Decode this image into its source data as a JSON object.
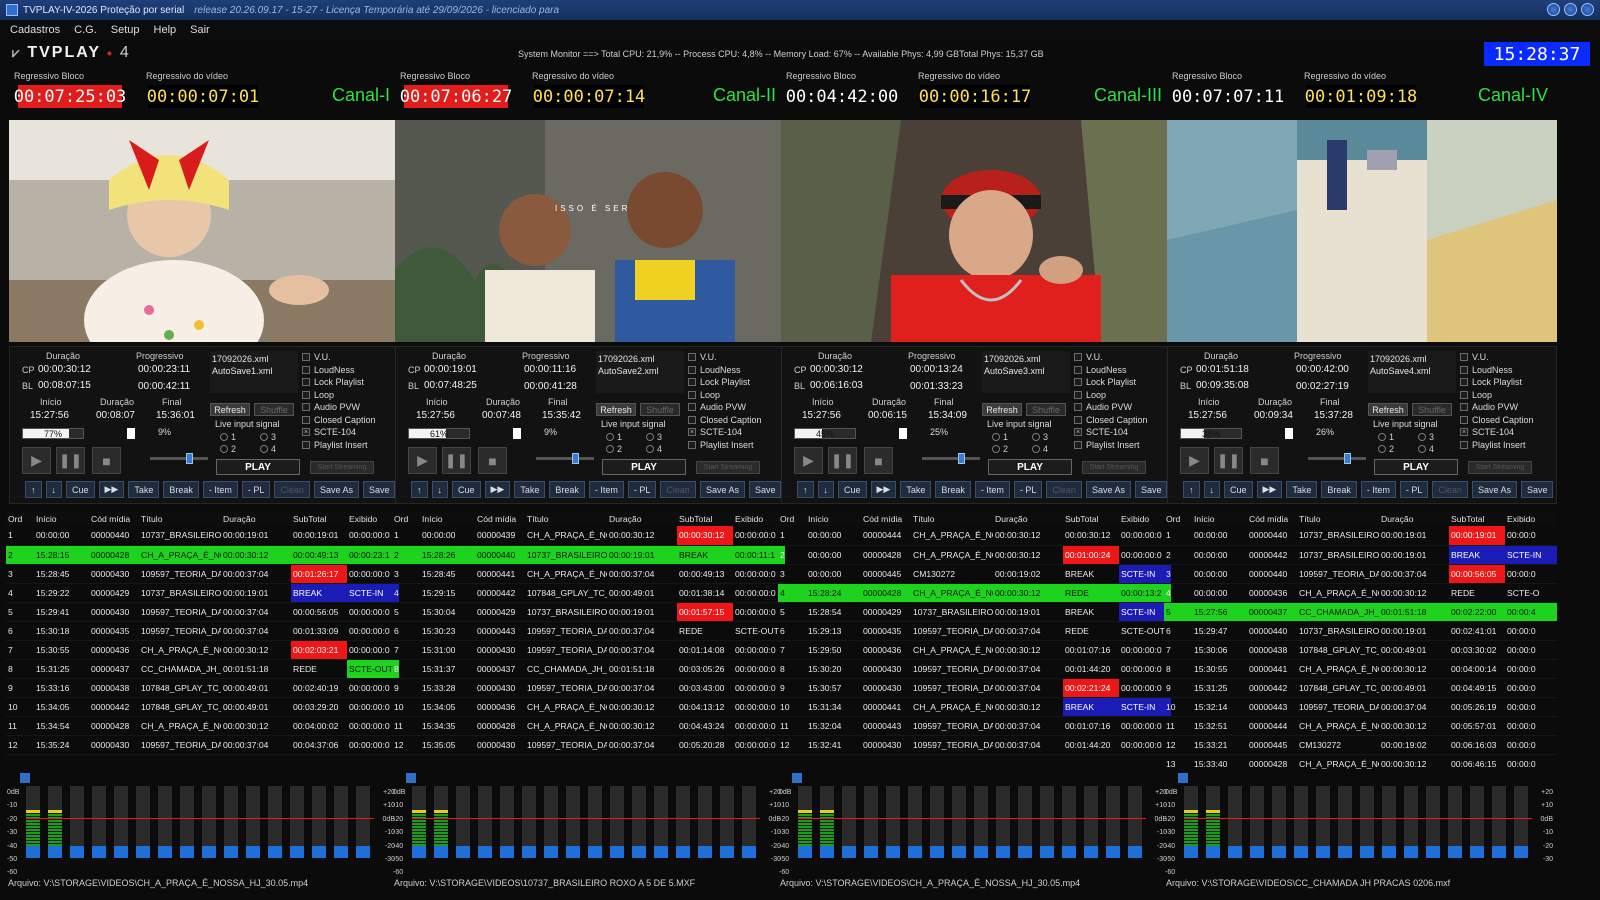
{
  "window": {
    "title": "TVPLAY-IV-2026 Proteção por serial",
    "release": "release 20.26.09.17 - 15-27 - Licença Temporária até 29/09/2026 - licenciado para"
  },
  "menu": [
    "Cadastros",
    "C.G.",
    "Setup",
    "Help",
    "Sair"
  ],
  "logo": {
    "text": "TVPLAY",
    "num": "4"
  },
  "system_monitor": "System Monitor ==> Total CPU: 21,9% -- Process CPU: 4,8% -- Memory Load: 67% -- Available Phys: 4,99 GBTotal Phys: 15,37 GB",
  "clock": "15:28:37",
  "labels": {
    "reg_bloco": "Regressivo Bloco",
    "reg_video": "Regressivo do vídeo",
    "duracao": "Duração",
    "progressivo": "Progressivo",
    "inicio": "Início",
    "final": "Final",
    "cp": "CP",
    "bl": "BL",
    "refresh": "Refresh",
    "shuffle": "Shuffle",
    "live_input": "Live input signal",
    "play": "PLAY",
    "start_streaming": "Start Streaming",
    "overlay": "ISSO É SER"
  },
  "options": [
    "V.U.",
    "LoudNess",
    "Lock Playlist",
    "Loop",
    "Audio PVW",
    "Closed Caption",
    "SCTE-104",
    "Playlist Insert"
  ],
  "buttons": [
    "Cue",
    "Take",
    "Break",
    "- Item",
    "- PL",
    "Clean",
    "Save As",
    "Save"
  ],
  "columns": [
    "Ord",
    "Início",
    "Cód mídia",
    "Título",
    "Duração",
    "SubTotal",
    "Exibido"
  ],
  "channels": [
    {
      "name": "Canal-I",
      "reg_bloco": "00:07:25:03",
      "reg_bloco_red": true,
      "reg_video": "00:00:07:01",
      "cp_dur": "00:00:30:12",
      "cp_prog": "00:00:23:11",
      "bl_dur": "00:08:07:15",
      "bl_prog": "00:00:42:11",
      "inicio": "15:27:56",
      "duracao": "00:08:07",
      "final": "15:36:01",
      "xml": "17092026.xml",
      "autosave": "AutoSave1.xml",
      "progress_pct": "77%",
      "progress2_pct": "9%",
      "rows": [
        {
          "ord": "1",
          "ini": "00:00:00",
          "cod": "00000440",
          "tit": "10737_BRASILEIRO_ROXO",
          "dur": "00:00:19:01",
          "sub": "00:00:19:01",
          "exi": "00:00:00:0",
          "sub_c": "",
          "exi_c": ""
        },
        {
          "ord": "2",
          "ini": "15:28:15",
          "cod": "00000428",
          "tit": "CH_A_PRAÇA_É_NOSSA",
          "dur": "00:00:30:12",
          "sub": "00:00:49:13",
          "exi": "00:00:23:1",
          "sub_c": "",
          "exi_c": "",
          "cur": true
        },
        {
          "ord": "3",
          "ini": "15:28:45",
          "cod": "00000430",
          "tit": "109597_TEORIA_DA_MAGIA",
          "dur": "00:00:37:04",
          "sub": "00:01:26:17",
          "exi": "00:00:00:0",
          "sub_c": "red",
          "exi_c": ""
        },
        {
          "ord": "4",
          "ini": "15:29:22",
          "cod": "00000429",
          "tit": "10737_BRASILEIRO_ROXO",
          "dur": "00:00:19:01",
          "sub": "BREAK",
          "exi": "SCTE-IN",
          "sub_c": "blue",
          "exi_c": "blue"
        },
        {
          "ord": "5",
          "ini": "15:29:41",
          "cod": "00000430",
          "tit": "109597_TEORIA_DA_MAGIA",
          "dur": "00:00:37:04",
          "sub": "00:00:56:05",
          "exi": "00:00:00:0",
          "sub_c": "",
          "exi_c": ""
        },
        {
          "ord": "6",
          "ini": "15:30:18",
          "cod": "00000435",
          "tit": "109597_TEORIA_DA_MAGIA",
          "dur": "00:00:37:04",
          "sub": "00:01:33:09",
          "exi": "00:00:00:0",
          "sub_c": "",
          "exi_c": ""
        },
        {
          "ord": "7",
          "ini": "15:30:55",
          "cod": "00000436",
          "tit": "CH_A_PRAÇA_É_NOSSA",
          "dur": "00:00:30:12",
          "sub": "00:02:03:21",
          "exi": "00:00:00:0",
          "sub_c": "red",
          "exi_c": ""
        },
        {
          "ord": "8",
          "ini": "15:31:25",
          "cod": "00000437",
          "tit": "CC_CHAMADA_JH_PRACAS",
          "dur": "00:01:51:18",
          "sub": "REDE",
          "exi": "SCTE-OUT",
          "sub_c": "",
          "exi_c": "green"
        },
        {
          "ord": "9",
          "ini": "15:33:16",
          "cod": "00000438",
          "tit": "107848_GPLAY_TC_LOCAL",
          "dur": "00:00:49:01",
          "sub": "00:02:40:19",
          "exi": "00:00:00:0",
          "sub_c": "",
          "exi_c": ""
        },
        {
          "ord": "10",
          "ini": "15:34:05",
          "cod": "00000442",
          "tit": "107848_GPLAY_TC_LOCAL",
          "dur": "00:00:49:01",
          "sub": "00:03:29:20",
          "exi": "00:00:00:0",
          "sub_c": "",
          "exi_c": ""
        },
        {
          "ord": "11",
          "ini": "15:34:54",
          "cod": "00000428",
          "tit": "CH_A_PRAÇA_É_NOSSA",
          "dur": "00:00:30:12",
          "sub": "00:04:00:02",
          "exi": "00:00:00:0",
          "sub_c": "",
          "exi_c": ""
        },
        {
          "ord": "12",
          "ini": "15:35:24",
          "cod": "00000430",
          "tit": "109597_TEORIA_DA_MAGIA",
          "dur": "00:00:37:04",
          "sub": "00:04:37:06",
          "exi": "00:00:00:0",
          "sub_c": "",
          "exi_c": ""
        }
      ],
      "status": "Arquivo: V:\\STORAGE\\VIDEOS\\CH_A_PRAÇA_É_NOSSA_HJ_30.05.mp4"
    },
    {
      "name": "Canal-II",
      "reg_bloco": "00:07:06:27",
      "reg_bloco_red": true,
      "reg_video": "00:00:07:14",
      "cp_dur": "00:00:19:01",
      "cp_prog": "00:00:11:16",
      "bl_dur": "00:07:48:25",
      "bl_prog": "00:00:41:28",
      "inicio": "15:27:56",
      "duracao": "00:07:48",
      "final": "15:35:42",
      "xml": "17092026.xml",
      "autosave": "AutoSave2.xml",
      "progress_pct": "61%",
      "progress2_pct": "9%",
      "rows": [
        {
          "ord": "1",
          "ini": "00:00:00",
          "cod": "00000439",
          "tit": "CH_A_PRAÇA_É_NOSSA",
          "dur": "00:00:30:12",
          "sub": "00:00:30:12",
          "exi": "00:00:00:0",
          "sub_c": "red",
          "exi_c": ""
        },
        {
          "ord": "2",
          "ini": "15:28:26",
          "cod": "00000440",
          "tit": "10737_BRASILEIRO_ROXO",
          "dur": "00:00:19:01",
          "sub": "BREAK",
          "exi": "00:00:11:1",
          "sub_c": "blue",
          "exi_c": "",
          "cur": true
        },
        {
          "ord": "3",
          "ini": "15:28:45",
          "cod": "00000441",
          "tit": "CH_A_PRAÇA_É_NOSSA",
          "dur": "00:00:37:04",
          "sub": "00:00:49:13",
          "exi": "00:00:00:0",
          "sub_c": "",
          "exi_c": ""
        },
        {
          "ord": "4",
          "ini": "15:29:15",
          "cod": "00000442",
          "tit": "107848_GPLAY_TC_LOCAL",
          "dur": "00:00:49:01",
          "sub": "00:01:38:14",
          "exi": "00:00:00:0",
          "sub_c": "",
          "exi_c": ""
        },
        {
          "ord": "5",
          "ini": "15:30:04",
          "cod": "00000429",
          "tit": "10737_BRASILEIRO_ROXO",
          "dur": "00:00:19:01",
          "sub": "00:01:57:15",
          "exi": "00:00:00:0",
          "sub_c": "red",
          "exi_c": ""
        },
        {
          "ord": "6",
          "ini": "15:30:23",
          "cod": "00000443",
          "tit": "109597_TEORIA_DA_MAGIA",
          "dur": "00:00:37:04",
          "sub": "REDE",
          "exi": "SCTE-OUT",
          "sub_c": "",
          "exi_c": ""
        },
        {
          "ord": "7",
          "ini": "15:31:00",
          "cod": "00000430",
          "tit": "109597_TEORIA_DA_MAGIA",
          "dur": "00:00:37:04",
          "sub": "00:01:14:08",
          "exi": "00:00:00:0",
          "sub_c": "",
          "exi_c": ""
        },
        {
          "ord": "8",
          "ini": "15:31:37",
          "cod": "00000437",
          "tit": "CC_CHAMADA_JH_PRACAS",
          "dur": "00:01:51:18",
          "sub": "00:03:05:26",
          "exi": "00:00:00:0",
          "sub_c": "",
          "exi_c": ""
        },
        {
          "ord": "9",
          "ini": "15:33:28",
          "cod": "00000430",
          "tit": "109597_TEORIA_DA_MAGIA",
          "dur": "00:00:37:04",
          "sub": "00:03:43:00",
          "exi": "00:00:00:0",
          "sub_c": "",
          "exi_c": ""
        },
        {
          "ord": "10",
          "ini": "15:34:05",
          "cod": "00000436",
          "tit": "CH_A_PRAÇA_É_NOSSA",
          "dur": "00:00:30:12",
          "sub": "00:04:13:12",
          "exi": "00:00:00:0",
          "sub_c": "",
          "exi_c": ""
        },
        {
          "ord": "11",
          "ini": "15:34:35",
          "cod": "00000428",
          "tit": "CH_A_PRAÇA_É_NOSSA",
          "dur": "00:00:30:12",
          "sub": "00:04:43:24",
          "exi": "00:00:00:0",
          "sub_c": "",
          "exi_c": ""
        },
        {
          "ord": "12",
          "ini": "15:35:05",
          "cod": "00000430",
          "tit": "109597_TEORIA_DA_MAGIA",
          "dur": "00:00:37:04",
          "sub": "00:05:20:28",
          "exi": "00:00:00:0",
          "sub_c": "",
          "exi_c": ""
        }
      ],
      "status": "Arquivo: V:\\STORAGE\\VIDEOS\\10737_BRASILEIRO ROXO A 5 DE 5.MXF"
    },
    {
      "name": "Canal-III",
      "reg_bloco": "00:04:42:00",
      "reg_bloco_red": false,
      "reg_video": "00:00:16:17",
      "cp_dur": "00:00:30:12",
      "cp_prog": "00:00:13:24",
      "bl_dur": "00:06:16:03",
      "bl_prog": "00:01:33:23",
      "inicio": "15:27:56",
      "duracao": "00:06:15",
      "final": "15:34:09",
      "xml": "17092026.xml",
      "autosave": "AutoSave3.xml",
      "progress_pct": "45%",
      "progress2_pct": "25%",
      "rows": [
        {
          "ord": "1",
          "ini": "00:00:00",
          "cod": "00000444",
          "tit": "CH_A_PRAÇA_É_NOSSA",
          "dur": "00:00:30:12",
          "sub": "00:00:30:12",
          "exi": "00:00:00:0",
          "sub_c": "",
          "exi_c": ""
        },
        {
          "ord": "2",
          "ini": "00:00:00",
          "cod": "00000428",
          "tit": "CH_A_PRAÇA_É_NOSSA",
          "dur": "00:00:30:12",
          "sub": "00:01:00:24",
          "exi": "00:00:00:0",
          "sub_c": "red",
          "exi_c": ""
        },
        {
          "ord": "3",
          "ini": "00:00:00",
          "cod": "00000445",
          "tit": "CM130272",
          "dur": "00:00:19:02",
          "sub": "BREAK",
          "exi": "SCTE-IN",
          "sub_c": "",
          "exi_c": "blue"
        },
        {
          "ord": "4",
          "ini": "15:28:24",
          "cod": "00000428",
          "tit": "CH_A_PRAÇA_É_NOSSA",
          "dur": "00:00:30:12",
          "sub": "REDE",
          "exi": "00:00:13:2",
          "sub_c": "",
          "exi_c": "",
          "cur": true
        },
        {
          "ord": "5",
          "ini": "15:28:54",
          "cod": "00000429",
          "tit": "10737_BRASILEIRO_ROXO",
          "dur": "00:00:19:01",
          "sub": "BREAK",
          "exi": "SCTE-IN",
          "sub_c": "",
          "exi_c": "blue"
        },
        {
          "ord": "6",
          "ini": "15:29:13",
          "cod": "00000435",
          "tit": "109597_TEORIA_DA_MAGIA",
          "dur": "00:00:37:04",
          "sub": "REDE",
          "exi": "SCTE-OUT",
          "sub_c": "",
          "exi_c": ""
        },
        {
          "ord": "7",
          "ini": "15:29:50",
          "cod": "00000436",
          "tit": "CH_A_PRAÇA_É_NOSSA",
          "dur": "00:00:30:12",
          "sub": "00:01:07:16",
          "exi": "00:00:00:0",
          "sub_c": "",
          "exi_c": ""
        },
        {
          "ord": "8",
          "ini": "15:30:20",
          "cod": "00000430",
          "tit": "109597_TEORIA_DA_MAGIA",
          "dur": "00:00:37:04",
          "sub": "00:01:44:20",
          "exi": "00:00:00:0",
          "sub_c": "",
          "exi_c": ""
        },
        {
          "ord": "9",
          "ini": "15:30:57",
          "cod": "00000430",
          "tit": "109597_TEORIA_DA_MAGIA",
          "dur": "00:00:37:04",
          "sub": "00:02:21:24",
          "exi": "00:00:00:0",
          "sub_c": "red",
          "exi_c": ""
        },
        {
          "ord": "10",
          "ini": "15:31:34",
          "cod": "00000441",
          "tit": "CH_A_PRAÇA_É_NOSSA",
          "dur": "00:00:30:12",
          "sub": "BREAK",
          "exi": "SCTE-IN",
          "sub_c": "blue",
          "exi_c": "blue"
        },
        {
          "ord": "11",
          "ini": "15:32:04",
          "cod": "00000443",
          "tit": "109597_TEORIA_DA_MAGIA",
          "dur": "00:00:37:04",
          "sub": "00:01:07:16",
          "exi": "00:00:00:0",
          "sub_c": "",
          "exi_c": ""
        },
        {
          "ord": "12",
          "ini": "15:32:41",
          "cod": "00000430",
          "tit": "109597_TEORIA_DA_MAGIA",
          "dur": "00:00:37:04",
          "sub": "00:01:44:20",
          "exi": "00:00:00:0",
          "sub_c": "",
          "exi_c": ""
        }
      ],
      "status": "Arquivo: V:\\STORAGE\\VIDEOS\\CH_A_PRAÇA_É_NOSSA_HJ_30.05.mp4"
    },
    {
      "name": "Canal-IV",
      "reg_bloco": "00:07:07:11",
      "reg_bloco_red": false,
      "reg_video": "00:01:09:18",
      "cp_dur": "00:01:51:18",
      "cp_prog": "00:00:42:00",
      "bl_dur": "00:09:35:08",
      "bl_prog": "00:02:27:19",
      "inicio": "15:27:56",
      "duracao": "00:09:34",
      "final": "15:37:28",
      "xml": "17092026.xml",
      "autosave": "AutoSave4.xml",
      "progress_pct": "38%",
      "progress2_pct": "26%",
      "rows": [
        {
          "ord": "1",
          "ini": "00:00:00",
          "cod": "00000440",
          "tit": "10737_BRASILEIRO_ROXO",
          "dur": "00:00:19:01",
          "sub": "00:00:19:01",
          "exi": "00:00:0",
          "sub_c": "red",
          "exi_c": ""
        },
        {
          "ord": "2",
          "ini": "00:00:00",
          "cod": "00000442",
          "tit": "10737_BRASILEIRO_ROXO",
          "dur": "00:00:19:01",
          "sub": "BREAK",
          "exi": "SCTE-IN",
          "sub_c": "blue",
          "exi_c": "blue"
        },
        {
          "ord": "3",
          "ini": "00:00:00",
          "cod": "00000440",
          "tit": "109597_TEORIA_DA_MAGIA",
          "dur": "00:00:37:04",
          "sub": "00:00:56:05",
          "exi": "00:00:0",
          "sub_c": "red",
          "exi_c": ""
        },
        {
          "ord": "4",
          "ini": "00:00:00",
          "cod": "00000436",
          "tit": "CH_A_PRAÇA_É_NOSSA",
          "dur": "00:00:30:12",
          "sub": "REDE",
          "exi": "SCTE-O",
          "sub_c": "",
          "exi_c": ""
        },
        {
          "ord": "5",
          "ini": "15:27:56",
          "cod": "00000437",
          "tit": "CC_CHAMADA_JH_PRACAS",
          "dur": "00:01:51:18",
          "sub": "00:02:22:00",
          "exi": "00:00:4",
          "sub_c": "",
          "exi_c": "",
          "cur": true
        },
        {
          "ord": "6",
          "ini": "15:29:47",
          "cod": "00000440",
          "tit": "10737_BRASILEIRO_ROXO",
          "dur": "00:00:19:01",
          "sub": "00:02:41:01",
          "exi": "00:00:0",
          "sub_c": "",
          "exi_c": ""
        },
        {
          "ord": "7",
          "ini": "15:30:06",
          "cod": "00000438",
          "tit": "107848_GPLAY_TC_LOCAL",
          "dur": "00:00:49:01",
          "sub": "00:03:30:02",
          "exi": "00:00:0",
          "sub_c": "",
          "exi_c": ""
        },
        {
          "ord": "8",
          "ini": "15:30:55",
          "cod": "00000441",
          "tit": "CH_A_PRAÇA_É_NOSSA",
          "dur": "00:00:30:12",
          "sub": "00:04:00:14",
          "exi": "00:00:0",
          "sub_c": "",
          "exi_c": ""
        },
        {
          "ord": "9",
          "ini": "15:31:25",
          "cod": "00000442",
          "tit": "107848_GPLAY_TC_LOCAL",
          "dur": "00:00:49:01",
          "sub": "00:04:49:15",
          "exi": "00:00:0",
          "sub_c": "",
          "exi_c": ""
        },
        {
          "ord": "10",
          "ini": "15:32:14",
          "cod": "00000443",
          "tit": "109597_TEORIA_DA_MAGIA",
          "dur": "00:00:37:04",
          "sub": "00:05:26:19",
          "exi": "00:00:0",
          "sub_c": "",
          "exi_c": ""
        },
        {
          "ord": "11",
          "ini": "15:32:51",
          "cod": "00000444",
          "tit": "CH_A_PRAÇA_É_NOSSA",
          "dur": "00:00:30:12",
          "sub": "00:05:57:01",
          "exi": "00:00:0",
          "sub_c": "",
          "exi_c": ""
        },
        {
          "ord": "12",
          "ini": "15:33:21",
          "cod": "00000445",
          "tit": "CM130272",
          "dur": "00:00:19:02",
          "sub": "00:06:16:03",
          "exi": "00:00:0",
          "sub_c": "",
          "exi_c": ""
        },
        {
          "ord": "13",
          "ini": "15:33:40",
          "cod": "00000428",
          "tit": "CH_A_PRAÇA_É_NOSSA",
          "dur": "00:00:30:12",
          "sub": "00:06:46:15",
          "exi": "00:00:0",
          "sub_c": "",
          "exi_c": ""
        }
      ],
      "status": "Arquivo: V:\\STORAGE\\VIDEOS\\CC_CHAMADA JH PRACAS 0206.mxf"
    }
  ],
  "meters": {
    "scale_left": [
      "0dB",
      "-10",
      "-20",
      "-30",
      "-40",
      "-50",
      "-60"
    ],
    "scale_right": [
      "+20",
      "+10",
      "0dB",
      "-10",
      "-20",
      "-30"
    ],
    "levels": [
      0.55,
      0.55,
      0,
      0,
      0,
      0,
      0,
      0,
      0,
      0,
      0,
      0,
      0,
      0,
      0,
      0
    ]
  },
  "colors": {
    "current_row": "#1dd31d",
    "alert_red": "#ee1616",
    "break_blue": "#1b1bb5",
    "clock_bg": "#0a2bff",
    "channel_green": "#2fe040"
  }
}
